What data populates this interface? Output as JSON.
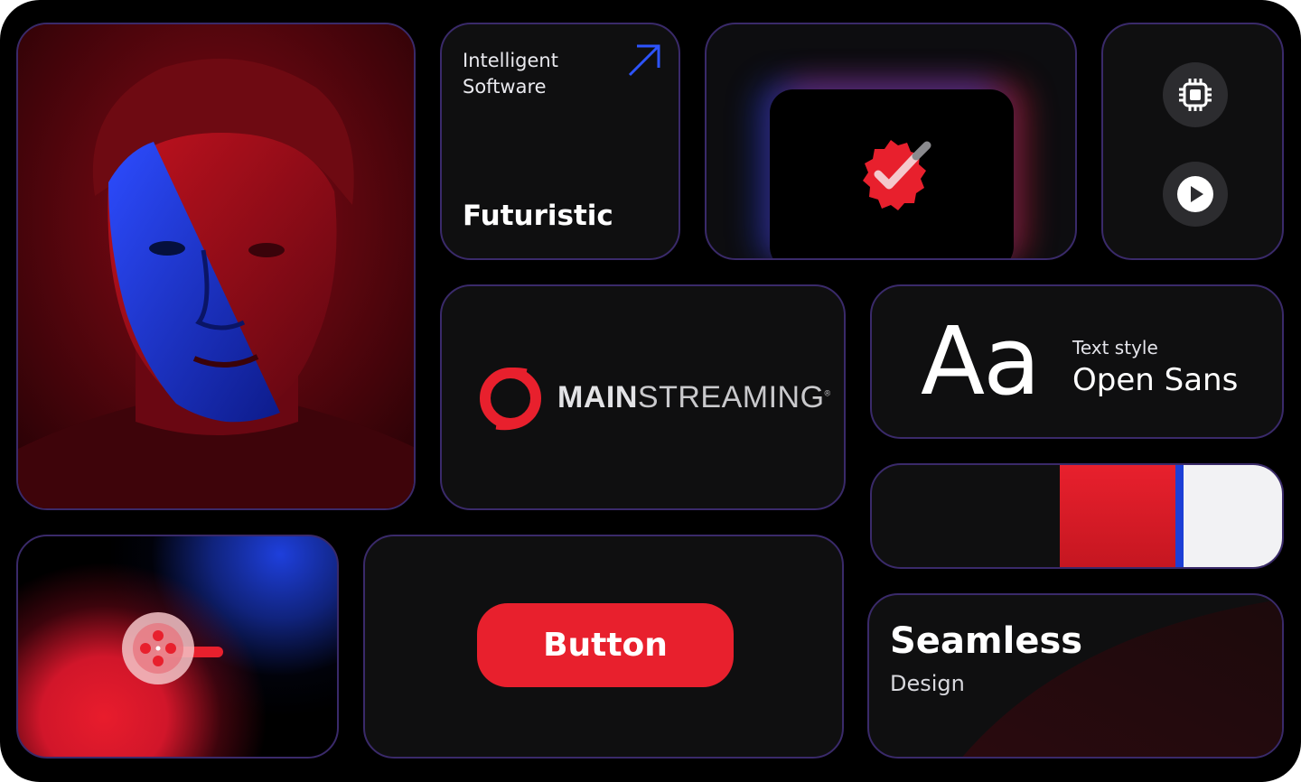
{
  "cards": {
    "intelligent": {
      "subtitle": "Intelligent\nSoftware",
      "title": "Futuristic"
    },
    "logo": {
      "brand_bold": "MAIN",
      "brand_rest": "STREAMING",
      "reg_mark": "®"
    },
    "typography": {
      "sample": "Aa",
      "label": "Text style",
      "font_name": "Open Sans"
    },
    "button": {
      "label": "Button"
    },
    "seamless": {
      "title": "Seamless",
      "subtitle": "Design"
    }
  },
  "icons": {
    "arrow": "arrow-up-right-icon",
    "badge": "verified-badge-icon",
    "chip": "chip-icon",
    "play": "play-icon",
    "film": "film-reel-icon",
    "logo": "mainstreaming-logo-icon"
  },
  "palette": {
    "brand_red": "#e8202d",
    "brand_blue": "#1d3fd6",
    "white": "#f2f2f4",
    "dark": "#0f0f10"
  }
}
